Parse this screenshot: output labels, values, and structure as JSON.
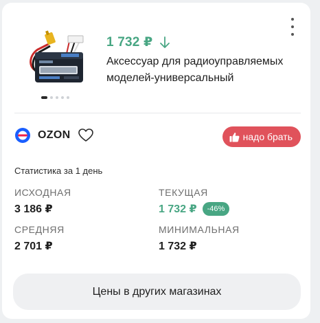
{
  "product": {
    "price": "1 732 ₽",
    "title": "Аксессуар для радиоуправляемых моделей-универсальный",
    "image_icon": "battery-pack-image",
    "carousel_count": 5,
    "carousel_active": 1
  },
  "shop": {
    "name": "OZON",
    "logo_icon": "ozon-logo",
    "favorite_icon": "heart-outline-icon"
  },
  "badge": {
    "label": "надо брать",
    "icon": "thumbs-up-icon",
    "color": "#e0525b"
  },
  "stats": {
    "title": "Статистика за 1 день",
    "initial_label": "Исходная",
    "initial_value": "3 186 ₽",
    "current_label": "Текущая",
    "current_value": "1 732 ₽",
    "discount": "-46%",
    "average_label": "Средняя",
    "average_value": "2 701 ₽",
    "minimum_label": "Минимальная",
    "minimum_value": "1 732 ₽"
  },
  "actions": {
    "other_stores_label": "Цены в других магазинах",
    "menu_icon": "more-vertical-icon"
  },
  "colors": {
    "accent_green": "#48a683",
    "accent_red": "#e0525b"
  }
}
